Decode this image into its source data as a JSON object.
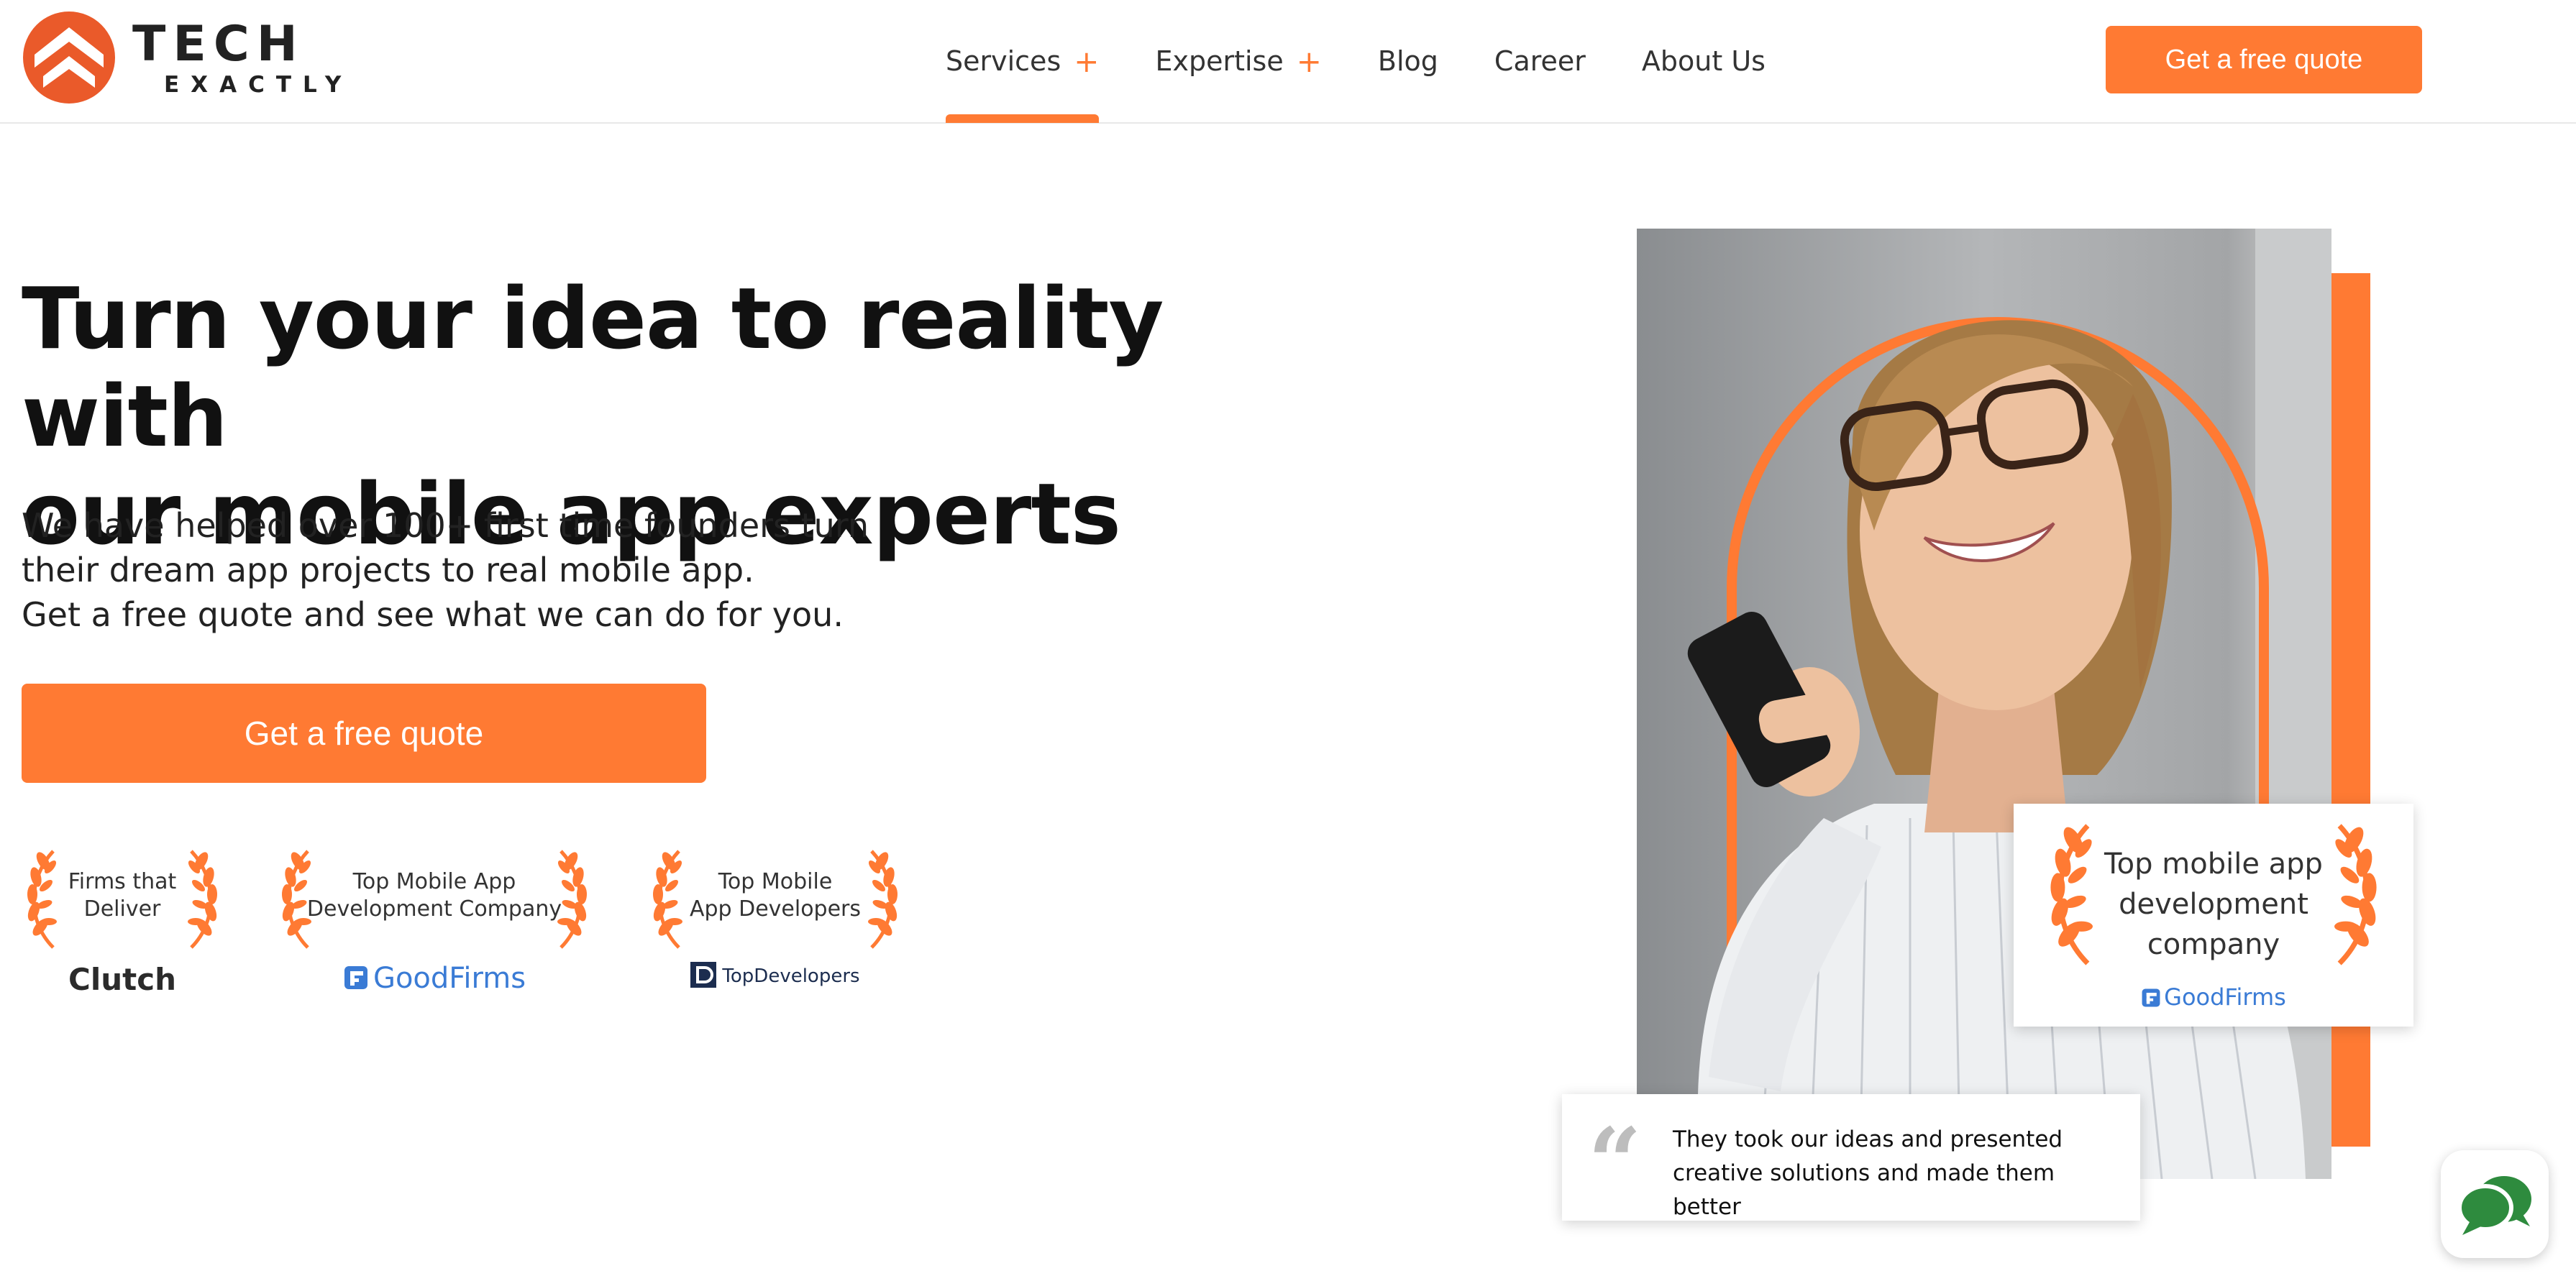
{
  "brand": {
    "name_line1": "TECH",
    "name_line2": "EXACTLY",
    "accent": "#ff7a33"
  },
  "nav": {
    "items": [
      {
        "label": "Services",
        "expandable": true,
        "active": true
      },
      {
        "label": "Expertise",
        "expandable": true,
        "active": false
      },
      {
        "label": "Blog",
        "expandable": false,
        "active": false
      },
      {
        "label": "Career",
        "expandable": false,
        "active": false
      },
      {
        "label": "About Us",
        "expandable": false,
        "active": false
      }
    ],
    "expand_glyph": "+",
    "cta_label": "Get a free quote"
  },
  "hero": {
    "title_line1": "Turn your idea to reality with",
    "title_line2": "our mobile app experts",
    "sub_line1": "We have helped over 100+ first time founders turn",
    "sub_line2": "their dream app projects to real mobile app.",
    "sub_line3": "Get a free quote and see what we can do for you.",
    "cta_label": "Get a free quote"
  },
  "badges": [
    {
      "line1": "Firms that",
      "line2": "Deliver",
      "brand": "Clutch"
    },
    {
      "line1": "Top Mobile App",
      "line2": "Development Company",
      "brand": "GoodFirms"
    },
    {
      "line1": "Top Mobile",
      "line2": "App Developers",
      "brand": "TopDevelopers"
    }
  ],
  "award_card": {
    "line1": "Top mobile app",
    "line2": "development",
    "line3": "company",
    "brand": "GoodFirms"
  },
  "testimonial": {
    "line1": "They took our ideas and presented",
    "line2": "creative solutions and made them better"
  },
  "icons": {
    "logo": "tech-exactly-logo-icon",
    "laurel": "laurel-wreath-icon",
    "goodfirms": "goodfirms-logo-icon",
    "topdevelopers": "topdevelopers-logo-icon",
    "quote": "quote-icon",
    "chat": "chat-bubbles-icon"
  },
  "colors": {
    "accent": "#ff7a33",
    "goodfirms_blue": "#3a7bd5",
    "chat_green": "#2e8b3e"
  }
}
